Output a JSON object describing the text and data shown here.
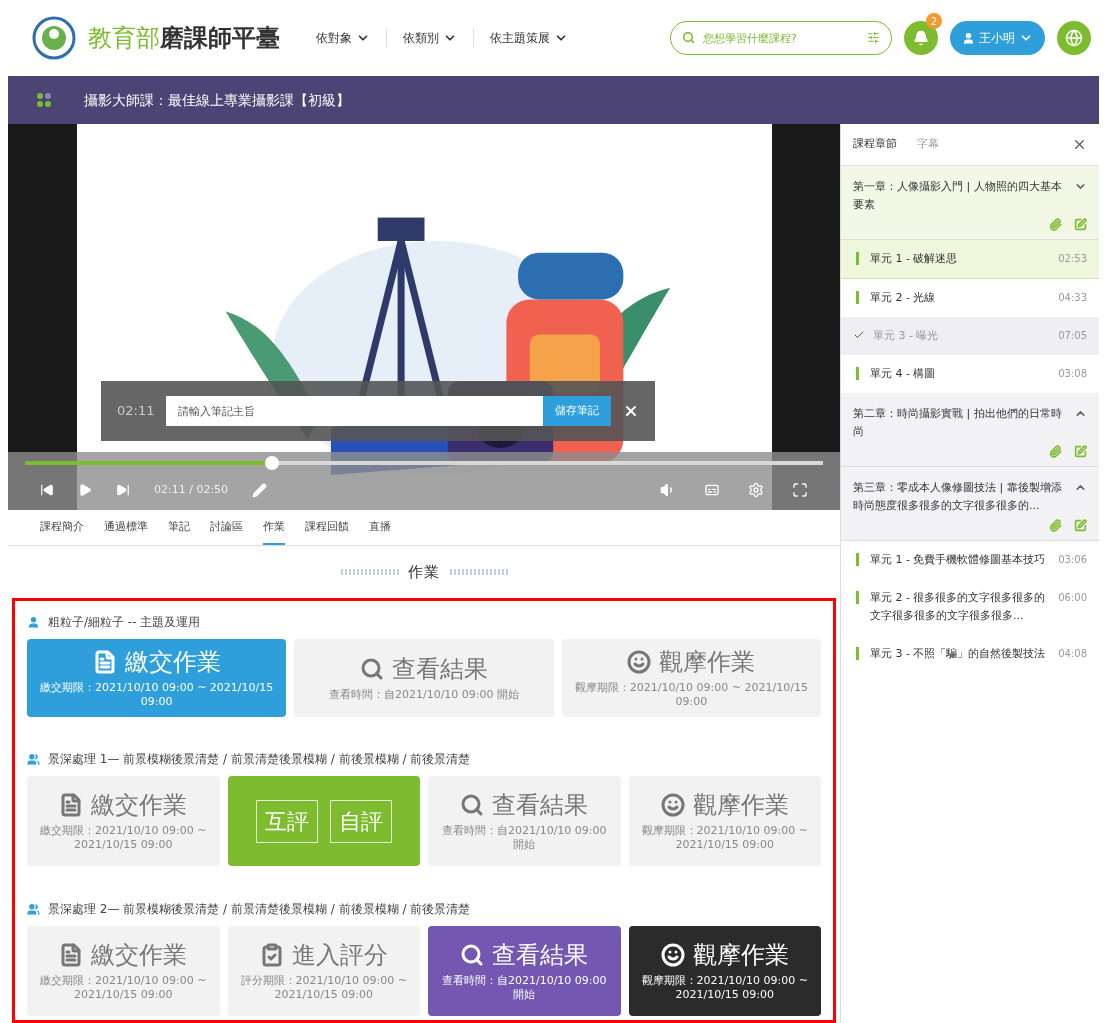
{
  "header": {
    "brand_light": "教育部",
    "brand_bold": "磨課師平臺",
    "nav": [
      "依對象",
      "依類別",
      "依主題策展"
    ],
    "search": {
      "placeholder": "您想學習什麼課程?"
    },
    "notifications": "2",
    "user": "王小明"
  },
  "course_bar": {
    "title": "攝影大師課：最佳線上專業攝影課【初級】"
  },
  "player": {
    "note": {
      "time": "02:11",
      "placeholder": "請輸入筆記主旨",
      "save": "儲存筆記"
    },
    "progress": {
      "level": 0.31
    },
    "time": "02:11 / 02:50"
  },
  "tabs": [
    {
      "label": "課程簡介",
      "selected": false
    },
    {
      "label": "通過標準",
      "selected": false
    },
    {
      "label": "筆記",
      "selected": false
    },
    {
      "label": "討論區",
      "selected": false
    },
    {
      "label": "作業",
      "selected": true
    },
    {
      "label": "課程回饋",
      "selected": false
    },
    {
      "label": "直播",
      "selected": false
    }
  ],
  "section_title": "作業",
  "assignments": [
    {
      "kind": "person",
      "title": "粗粒子/細粒子 -- 主題及運用",
      "buttons": [
        {
          "kind": "submit",
          "color": "#2f9fdc",
          "label": "繳交作業",
          "caption": "繳交期限：2021/10/10 09:00 ~ 2021/10/15 09:00"
        },
        {
          "kind": "result",
          "label": "查看結果",
          "caption": "查看時間：自2021/10/10 09:00 開始"
        },
        {
          "kind": "observe",
          "label": "觀摩作業",
          "caption": "觀摩期限：2021/10/10 09:00 ~ 2021/10/15 09:00"
        }
      ]
    },
    {
      "kind": "group",
      "title": "景深處理 1— 前景模糊後景清楚 / 前景清楚後景模糊 / 前後景模糊 / 前後景清楚",
      "buttons": [
        {
          "kind": "submit",
          "label": "繳交作業",
          "caption": "繳交期限：2021/10/10 09:00 ~ 2021/10/15 09:00"
        },
        {
          "kind": "review",
          "color": "#7dbb2f",
          "options": [
            "互評",
            "自評"
          ]
        },
        {
          "kind": "result",
          "label": "查看結果",
          "caption": "查看時間：自2021/10/10 09:00 開始"
        },
        {
          "kind": "observe",
          "label": "觀摩作業",
          "caption": "觀摩期限：2021/10/10 09:00 ~ 2021/10/15 09:00"
        }
      ]
    },
    {
      "kind": "group",
      "title": "景深處理 2— 前景模糊後景清楚 / 前景清楚後景模糊 / 前後景模糊 / 前後景清楚",
      "buttons": [
        {
          "kind": "submit",
          "label": "繳交作業",
          "caption": "繳交期限：2021/10/10 09:00 ~ 2021/10/15 09:00"
        },
        {
          "kind": "grade",
          "label": "進入評分",
          "caption": "評分期限：2021/10/10 09:00 ~ 2021/10/15 09:00"
        },
        {
          "kind": "result",
          "color": "#7357b0",
          "label": "查看結果",
          "caption": "查看時間：自2021/10/10 09:00 開始"
        },
        {
          "kind": "observe",
          "color": "#2b2b2b",
          "label": "觀摩作業",
          "caption": "觀摩期限：2021/10/10 09:00 ~ 2021/10/15 09:00"
        }
      ]
    }
  ],
  "sidebar": {
    "tabs": [
      {
        "label": "課程章節",
        "selected": true
      },
      {
        "label": "字幕",
        "selected": false
      }
    ],
    "chapters": [
      {
        "title": "第一章：人像攝影入門 | 人物照的四大基本要素",
        "expanded": true,
        "children": [
          {
            "title": "單元 1 - 破解迷思",
            "duration": "02:53",
            "watched": false,
            "selected": true
          },
          {
            "title": "單元 2 - 光線",
            "duration": "04:33",
            "watched": false,
            "selected": false
          },
          {
            "title": "單元 3 - 曝光",
            "duration": "07:05",
            "watched": true,
            "selected": false
          },
          {
            "title": "單元 4 - 構圖",
            "duration": "03:08",
            "watched": false,
            "selected": false
          }
        ]
      },
      {
        "title": "第二章：時尚攝影實戰 | 拍出他們的日常時尚",
        "expanded": false
      },
      {
        "title": "第三章：零成本人像修圖技法 | 靠後製增添時尚態度很多很多的文字很多很多的...",
        "expanded": false,
        "children": [
          {
            "title": "單元 1 - 免費手機軟體修圖基本技巧",
            "duration": "03:06",
            "watched": false,
            "selected": false
          },
          {
            "title": "單元 2 - 很多很多的文字很多很多的文字很多很多的文字很多很多...",
            "duration": "06:00",
            "watched": false,
            "selected": false
          },
          {
            "title": "單元 3 - 不照「騙」的自然後製技法",
            "duration": "04:08",
            "watched": false,
            "selected": false
          }
        ]
      }
    ]
  }
}
